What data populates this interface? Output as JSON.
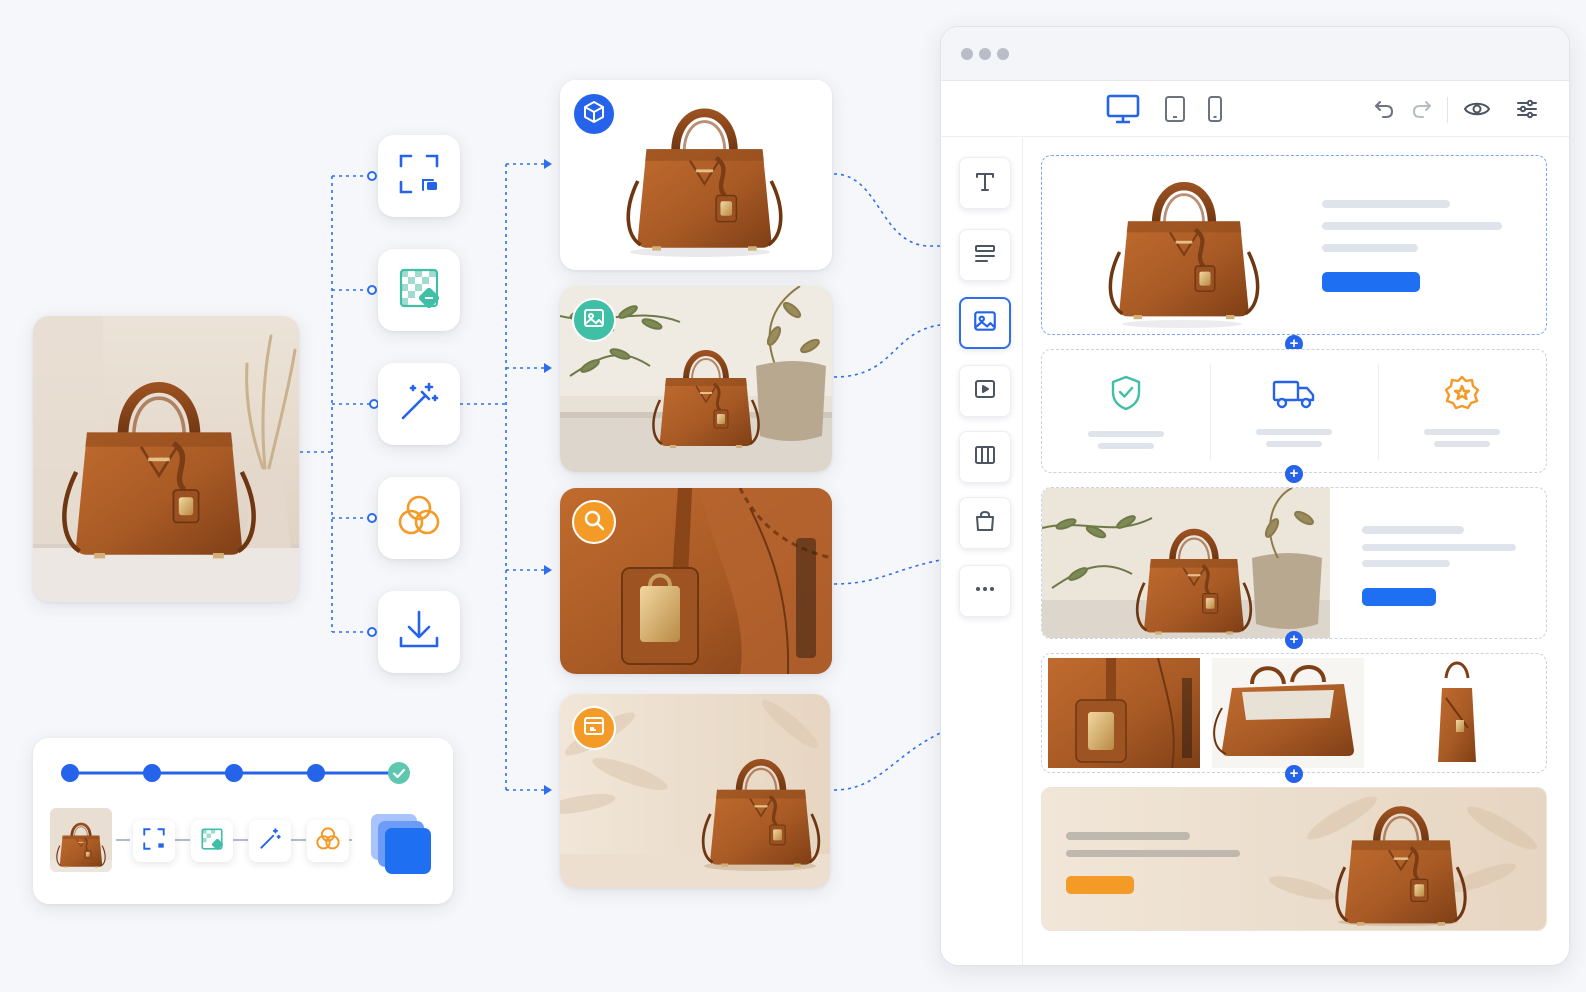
{
  "colors": {
    "accent_blue": "#2563eb",
    "accent_teal": "#3fbfa6",
    "accent_orange": "#f39a27",
    "leather_brown": "#a85a25",
    "page_bg": "#f6f7fa"
  },
  "tools": [
    {
      "name": "crop-icon"
    },
    {
      "name": "remove-background-icon"
    },
    {
      "name": "magic-wand-icon"
    },
    {
      "name": "color-blend-icon"
    },
    {
      "name": "download-icon"
    }
  ],
  "outputs": [
    {
      "scene": "white-background",
      "badge_icon": "cube-icon",
      "badge_color": "#2563eb"
    },
    {
      "scene": "lifestyle-plant",
      "badge_icon": "image-icon",
      "badge_color": "#3fbfa6"
    },
    {
      "scene": "detail-zoom",
      "badge_icon": "zoom-icon",
      "badge_color": "#f39a27"
    },
    {
      "scene": "banner-shadow",
      "badge_icon": "layout-icon",
      "badge_color": "#f39a27"
    }
  ],
  "pipeline": {
    "progress": 1.0,
    "steps": 5,
    "completed_icon": "check-circle-icon"
  },
  "browser": {
    "devices": [
      "desktop-icon",
      "tablet-icon",
      "mobile-icon"
    ],
    "active_device": "desktop-icon",
    "actions": [
      "undo-icon",
      "redo-icon",
      "preview-eye-icon",
      "settings-sliders-icon"
    ],
    "sidebar_tools": [
      "text-icon",
      "paragraph-icon",
      "image-icon",
      "video-icon",
      "columns-icon",
      "shopping-bag-icon",
      "more-icon"
    ],
    "active_sidebar_tool": "image-icon",
    "features": [
      "shield-check-icon",
      "truck-icon",
      "badge-star-icon"
    ]
  }
}
